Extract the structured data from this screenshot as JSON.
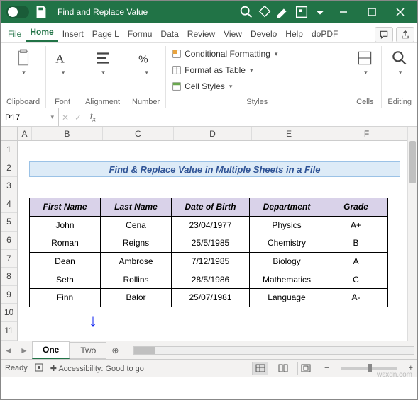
{
  "title": "Find and Replace Value",
  "ribbon": {
    "tabs": [
      "File",
      "Home",
      "Insert",
      "Page L",
      "Formu",
      "Data",
      "Review",
      "View",
      "Develo",
      "Help",
      "doPDF"
    ],
    "active_tab": "Home",
    "groups": {
      "clipboard": {
        "label": "Clipboard"
      },
      "font": {
        "label": "Font"
      },
      "alignment": {
        "label": "Alignment"
      },
      "number": {
        "label": "Number"
      },
      "styles": {
        "label": "Styles",
        "cond": "Conditional Formatting",
        "table": "Format as Table",
        "cell": "Cell Styles"
      },
      "cells": {
        "label": "Cells"
      },
      "editing": {
        "label": "Editing"
      }
    }
  },
  "name_box": "P17",
  "formula": "",
  "columns": [
    "A",
    "B",
    "C",
    "D",
    "E",
    "F"
  ],
  "rows": [
    "1",
    "2",
    "3",
    "4",
    "5",
    "6",
    "7",
    "8",
    "9",
    "10",
    "11"
  ],
  "sheet_title": "Find & Replace Value in Multiple Sheets in a File",
  "headers": [
    "First Name",
    "Last Name",
    "Date of Birth",
    "Department",
    "Grade"
  ],
  "data": [
    [
      "John",
      "Cena",
      "23/04/1977",
      "Physics",
      "A+"
    ],
    [
      "Roman",
      "Reigns",
      "25/5/1985",
      "Chemistry",
      "B"
    ],
    [
      "Dean",
      "Ambrose",
      "7/12/1985",
      "Biology",
      "A"
    ],
    [
      "Seth",
      "Rollins",
      "28/5/1986",
      "Mathematics",
      "C"
    ],
    [
      "Finn",
      "Balor",
      "25/07/1981",
      "Language",
      "A-"
    ]
  ],
  "sheets": {
    "active": "One",
    "other": "Two"
  },
  "status": {
    "ready": "Ready",
    "access": "Accessibility: Good to go"
  },
  "watermark": "wsxdn.com"
}
